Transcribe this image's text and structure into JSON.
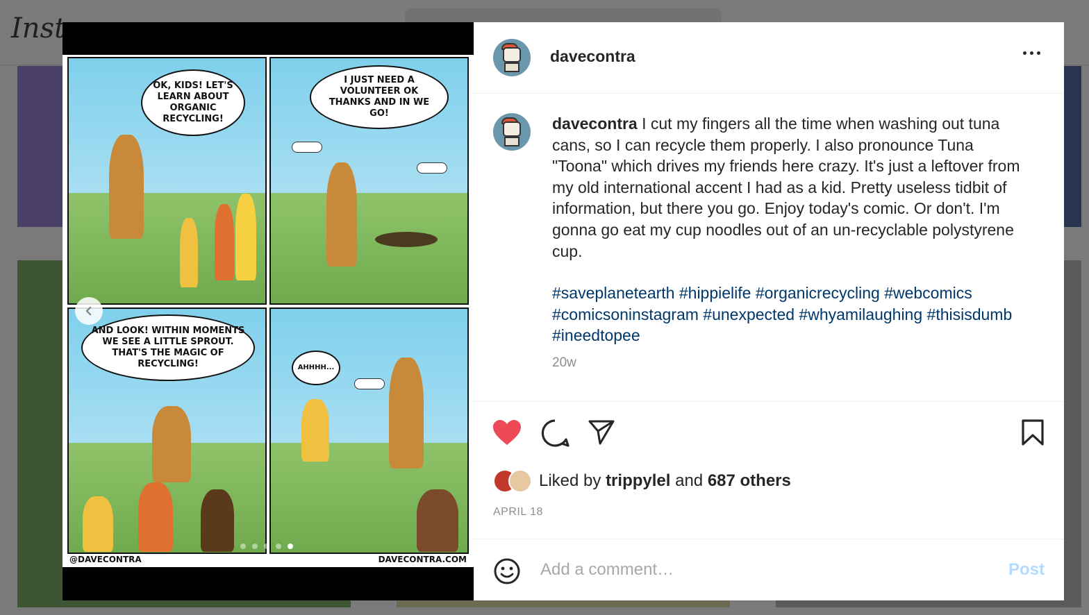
{
  "background": {
    "logo_text": "Insta"
  },
  "post": {
    "username": "davecontra",
    "caption_text": " I cut my fingers all the time when washing out tuna cans, so I can recycle them properly. I also pronounce Tuna \"Toona\" which drives my friends here crazy. It's just a leftover from my old international accent I had as a kid. Pretty useless tidbit of information, but there you go. Enjoy today's comic. Or don't. I'm gonna go eat my cup noodles out of an un-recyclable polystyrene cup.",
    "hashtags": "#saveplanetearth #hippielife #organicrecycling #webcomics #comicsoninstagram #unexpected #whyamilaughing #thisisdumb #ineedtopee",
    "time_ago": "20w",
    "liked_by_prefix": "Liked by ",
    "liked_by_user": "trippylel",
    "liked_by_and": " and ",
    "liked_by_others": "687 others",
    "date": "APRIL 18",
    "comment_placeholder": "Add a comment…",
    "post_button": "Post"
  },
  "comic": {
    "panel1_text": "OK, KIDS! LET'S LEARN ABOUT ORGANIC RECYCLING!",
    "panel2_text": "I JUST NEED A VOLUNTEER OK THANKS AND IN WE GO!",
    "panel3_text": "AND LOOK! WITHIN MOMENTS WE SEE A LITTLE SPROUT. THAT'S THE MAGIC OF RECYCLING!",
    "panel4_text": "AHHHH...",
    "footer_left": "@DAVECONTRA",
    "footer_right": "DAVECONTRA.COM",
    "slide_count": 5,
    "active_slide": 5
  },
  "colors": {
    "like_red": "#ed4956",
    "link_blue": "#00376b",
    "post_disabled": "#b3dbff"
  },
  "icons": [
    "heart-icon",
    "comment-icon",
    "share-icon",
    "bookmark-icon",
    "more-icon",
    "emoji-icon",
    "chevron-left-icon"
  ]
}
